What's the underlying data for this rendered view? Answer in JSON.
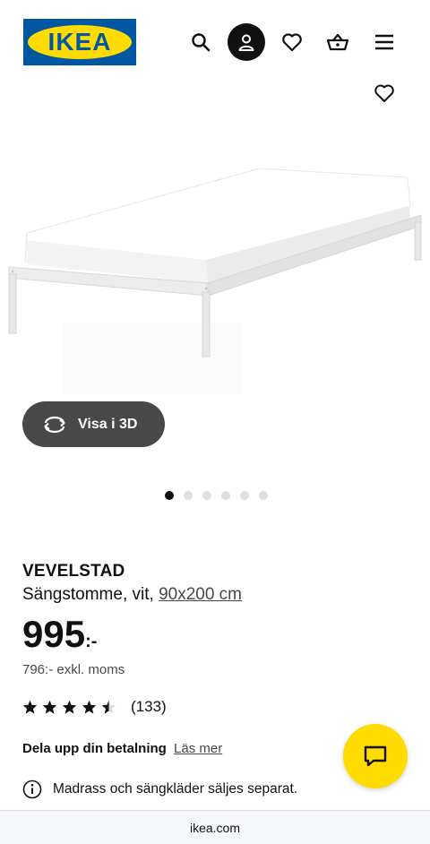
{
  "header": {
    "logo_text": "IKEA",
    "icons": [
      "search-icon",
      "account-icon",
      "heart-icon",
      "basket-icon",
      "menu-icon"
    ]
  },
  "gallery": {
    "view_3d_label": "Visa i 3D",
    "dots_total": 6,
    "dots_active": 1
  },
  "product": {
    "name": "VEVELSTAD",
    "description": "Sängstomme, vit,",
    "size_link": "90x200 cm",
    "price_int": "995",
    "price_suffix": ":-",
    "price_excl_vat": "796:- exkl. moms",
    "rating_value": 4.5,
    "rating_count": "(133)"
  },
  "payment": {
    "label": "Dela upp din betalning",
    "link": "Läs mer"
  },
  "notice": {
    "text": "Madrass och sängkläder säljes separat."
  },
  "browser": {
    "url": "ikea.com"
  },
  "colors": {
    "ikea_blue": "#0058A3",
    "ikea_yellow": "#FFDB00",
    "button_dark": "#484848"
  }
}
